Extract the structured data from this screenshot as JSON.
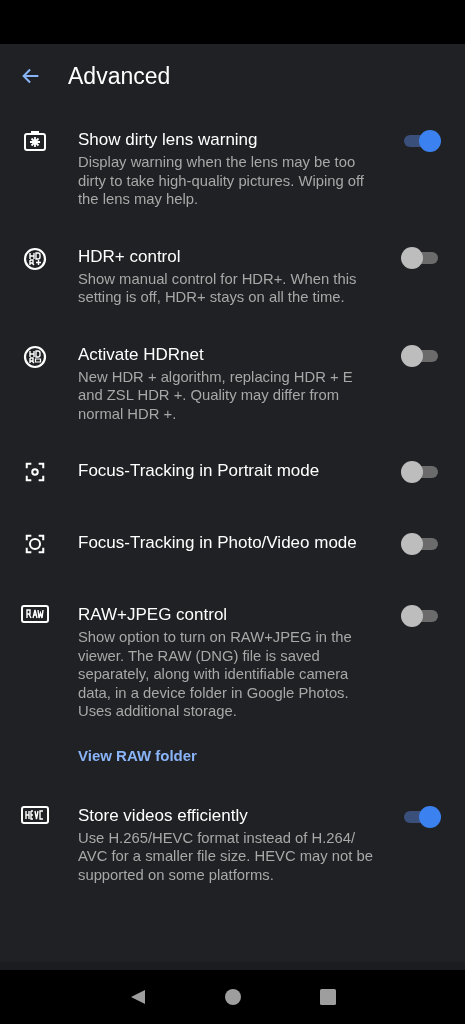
{
  "header": {
    "title": "Advanced"
  },
  "settings": [
    {
      "kind": "dirty-lens",
      "title": "Show dirty lens warning",
      "description": "Display warning when the lens may be too dirty to take high-quality pictures. Wiping off the lens may help.",
      "on": true
    },
    {
      "kind": "hdr",
      "title": "HDR+ control",
      "description": "Show manual control for HDR+. When this setting is off, HDR+ stays on all the time.",
      "on": false
    },
    {
      "kind": "hdrnet",
      "title": "Activate HDRnet",
      "description": "New HDR + algorithm, replacing HDR + E and ZSL HDR +. Quality may differ from normal HDR +.",
      "on": false
    },
    {
      "kind": "focus-small",
      "title": "Focus-Tracking in Portrait mode",
      "on": false
    },
    {
      "kind": "focus-large",
      "title": "Focus-Tracking in Photo/Video mode",
      "on": false
    },
    {
      "kind": "raw",
      "title": "RAW+JPEG control",
      "description": "Show option to turn on RAW+JPEG in the viewer. The RAW (DNG) file is saved separately, along with identifiable camera data, in a device folder in Google Photos. Uses additional storage.",
      "link": "View RAW folder",
      "on": false
    },
    {
      "kind": "hevc",
      "title": "Store videos efficiently",
      "description": "Use H.265/HEVC format instead of H.264/ AVC for a smaller file size. HEVC may not be supported on some platforms.",
      "on": true
    }
  ]
}
